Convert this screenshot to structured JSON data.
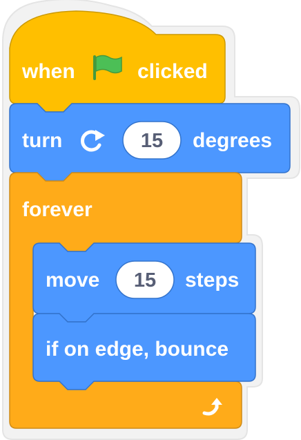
{
  "script": {
    "hat_block": {
      "prefix": "when",
      "icon": "green-flag-icon",
      "suffix": "clicked",
      "color": "#FFBF00"
    },
    "turn_block": {
      "prefix": "turn",
      "icon": "turn-clockwise-icon",
      "value": "15",
      "suffix": "degrees",
      "color": "#4C97FF"
    },
    "forever_block": {
      "label": "forever",
      "loop_icon": "loop-arrow-icon",
      "color": "#F0AC3A"
    },
    "move_block": {
      "prefix": "move",
      "value": "15",
      "suffix": "steps",
      "color": "#4C97FF"
    },
    "bounce_block": {
      "label": "if on edge, bounce",
      "color": "#4C97FF"
    }
  },
  "colors": {
    "events": "#FFBF00",
    "events_dark": "#CC9900",
    "motion": "#4C97FF",
    "motion_dark": "#3373CC",
    "control": "#FFAB19",
    "control_dark": "#CF8B17",
    "input_text": "#575E75",
    "flag": "#4CBF56"
  }
}
